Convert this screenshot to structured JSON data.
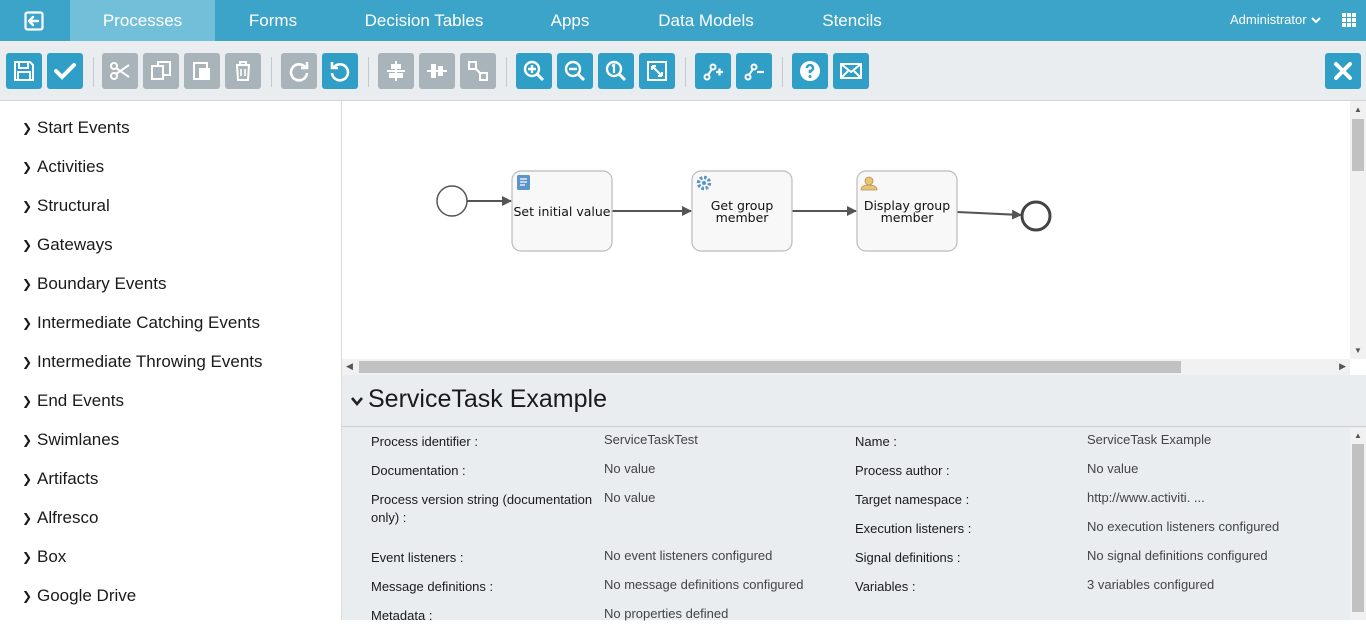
{
  "nav": {
    "tabs": [
      {
        "label": "Processes"
      },
      {
        "label": "Forms"
      },
      {
        "label": "Decision Tables"
      },
      {
        "label": "Apps"
      },
      {
        "label": "Data Models"
      },
      {
        "label": "Stencils"
      }
    ],
    "active_tab": "Processes",
    "user": "Administrator"
  },
  "toolbar": {
    "buttons": [
      "save-icon",
      "validate-icon",
      "cut-icon",
      "copy-icon",
      "paste-icon",
      "delete-icon",
      "redo-icon",
      "undo-icon",
      "align-horizontal-icon",
      "align-vertical-icon",
      "same-size-icon",
      "zoom-in-icon",
      "zoom-out-icon",
      "zoom-actual-icon",
      "zoom-fit-icon",
      "bend-point-add-icon",
      "bend-point-remove-icon",
      "help-icon",
      "feedback-icon",
      "close-icon"
    ],
    "disabled": [
      "cut-icon",
      "copy-icon",
      "paste-icon",
      "delete-icon",
      "align-horizontal-icon",
      "align-vertical-icon",
      "same-size-icon"
    ]
  },
  "palette": {
    "items": [
      {
        "label": "Start Events"
      },
      {
        "label": "Activities"
      },
      {
        "label": "Structural"
      },
      {
        "label": "Gateways"
      },
      {
        "label": "Boundary Events"
      },
      {
        "label": "Intermediate Catching Events"
      },
      {
        "label": "Intermediate Throwing Events"
      },
      {
        "label": "End Events"
      },
      {
        "label": "Swimlanes"
      },
      {
        "label": "Artifacts"
      },
      {
        "label": "Alfresco"
      },
      {
        "label": "Box"
      },
      {
        "label": "Google Drive"
      }
    ]
  },
  "diagram": {
    "tasks": [
      {
        "line1": "Set initial value",
        "line2": "",
        "icon": "script-icon"
      },
      {
        "line1": "Get group",
        "line2": "member",
        "icon": "gear-icon"
      },
      {
        "line1": "Display group",
        "line2": "member",
        "icon": "user-icon"
      }
    ]
  },
  "properties": {
    "title": "ServiceTask Example",
    "left": [
      {
        "label": "Process identifier :",
        "value": "ServiceTaskTest"
      },
      {
        "label": "Documentation :",
        "value": "No value"
      },
      {
        "label": "Process version string (documentation",
        "label2": "only) :",
        "value": "No value"
      },
      {
        "label": "Event listeners :",
        "value": "No event listeners configured"
      },
      {
        "label": "Message definitions :",
        "value": "No message definitions configured"
      },
      {
        "label": "Metadata :",
        "value": "No properties defined"
      }
    ],
    "right": [
      {
        "label": "Name :",
        "value": "ServiceTask Example"
      },
      {
        "label": "Process author :",
        "value": "No value"
      },
      {
        "label": "Target namespace :",
        "value": "http://www.activiti. ..."
      },
      {
        "label": "Execution listeners :",
        "value": "No execution listeners configured"
      },
      {
        "label": "Signal definitions :",
        "value": "No signal definitions configured"
      },
      {
        "label": "Variables :",
        "value": "3 variables configured"
      }
    ]
  },
  "colors": {
    "accent": "#3ca4c8",
    "button": "#2f9fc7",
    "disabled": "#a8b4ba",
    "panel": "#e9edf0"
  }
}
